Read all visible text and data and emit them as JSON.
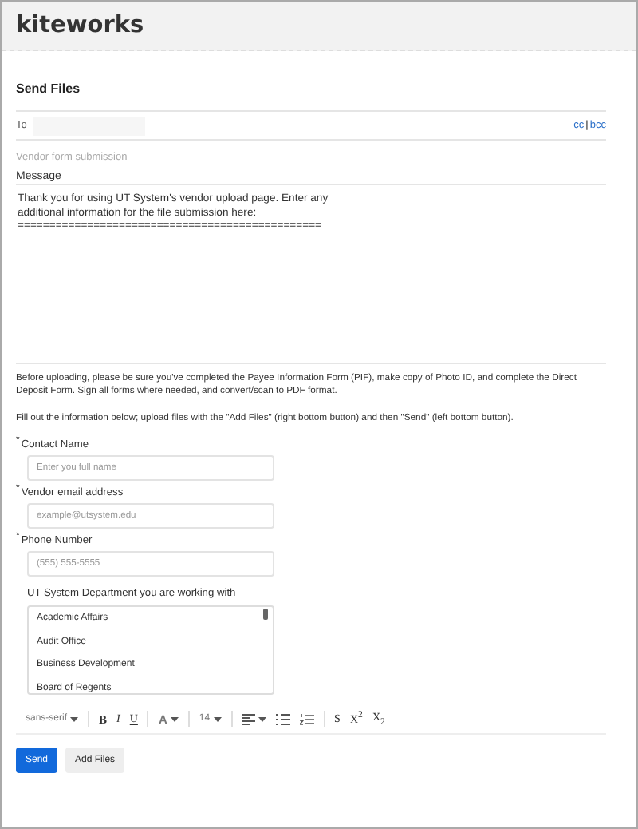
{
  "header": {
    "logo": "kiteworks"
  },
  "title": "Send Files",
  "to": {
    "label": "To",
    "links": [
      "cc",
      "bcc"
    ],
    "separator": "|"
  },
  "subject": {
    "placeholder": "Vendor form submission"
  },
  "message": {
    "label": "Message",
    "lines": [
      "Thank you for using UT System's vendor upload page.  Enter any",
      "additional information for the file submission here:",
      "================================================"
    ]
  },
  "instructions": [
    "Before uploading, please be sure you've completed the Payee Information Form (PIF), make copy of Photo ID, and complete the Direct Deposit Form. Sign all forms where needed, and convert/scan to PDF format.",
    "Fill out the information below; upload files with the \"Add Files\" (right bottom button) and then \"Send\" (left bottom button)."
  ],
  "fields": [
    {
      "label": "Contact Name",
      "required_mark": "*",
      "placeholder": "Enter you full name"
    },
    {
      "label": "Vendor email address",
      "required_mark": "*",
      "placeholder": "example@utsystem.edu"
    },
    {
      "label": "Phone Number",
      "required_mark": "*",
      "placeholder": "(555) 555-5555"
    }
  ],
  "department": {
    "label": "UT System Department you are working with",
    "options": [
      "Academic Affairs",
      "Audit Office",
      "Business Development",
      "Board of Regents"
    ]
  },
  "toolbar": [
    {
      "kind": "dropdown",
      "text": "sans-serif"
    },
    {
      "kind": "sep"
    },
    {
      "kind": "bold",
      "text": "B"
    },
    {
      "kind": "italic",
      "text": "I"
    },
    {
      "kind": "underline",
      "text": "U"
    },
    {
      "kind": "sep"
    },
    {
      "kind": "color",
      "text": "A"
    },
    {
      "kind": "sep"
    },
    {
      "kind": "dropdown",
      "text": "14"
    },
    {
      "kind": "sep"
    },
    {
      "kind": "align"
    },
    {
      "kind": "bullets"
    },
    {
      "kind": "numbers"
    },
    {
      "kind": "sep"
    },
    {
      "kind": "strike",
      "text": "S"
    },
    {
      "kind": "sup",
      "text": "X$^{2}$"
    },
    {
      "kind": "sub",
      "text": "X$_{2}$"
    }
  ],
  "buttons": [
    {
      "label": "Send",
      "primary": true
    },
    {
      "label": "Add Files",
      "primary": false
    }
  ]
}
